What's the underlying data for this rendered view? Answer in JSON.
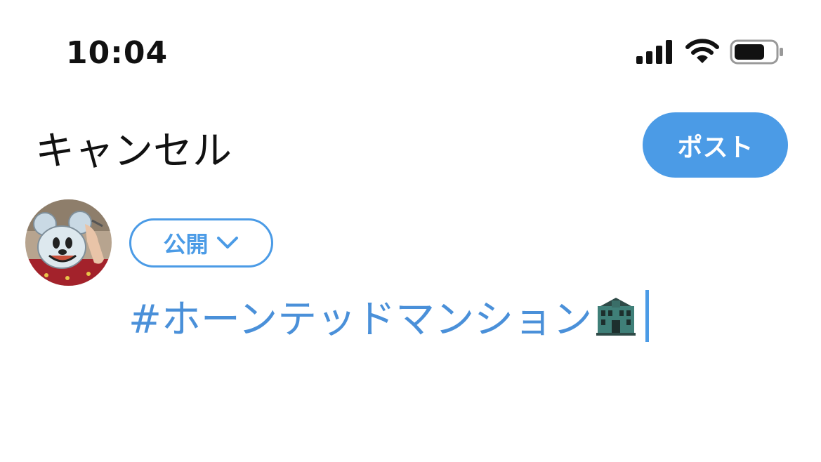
{
  "status_bar": {
    "time": "10:04",
    "signal_icon": "cellular-signal-icon",
    "wifi_icon": "wifi-icon",
    "battery_icon": "battery-icon"
  },
  "header": {
    "cancel_label": "キャンセル",
    "post_label": "ポスト"
  },
  "composer": {
    "avatar_icon": "user-avatar",
    "audience_label": "公開",
    "audience_chevron_icon": "chevron-down-icon",
    "text": "#ホーンテッドマンション",
    "trailing_emoji_icon": "haunted-mansion-emoji"
  },
  "colors": {
    "accent": "#4b9be6",
    "text": "#111111",
    "background": "#ffffff"
  }
}
